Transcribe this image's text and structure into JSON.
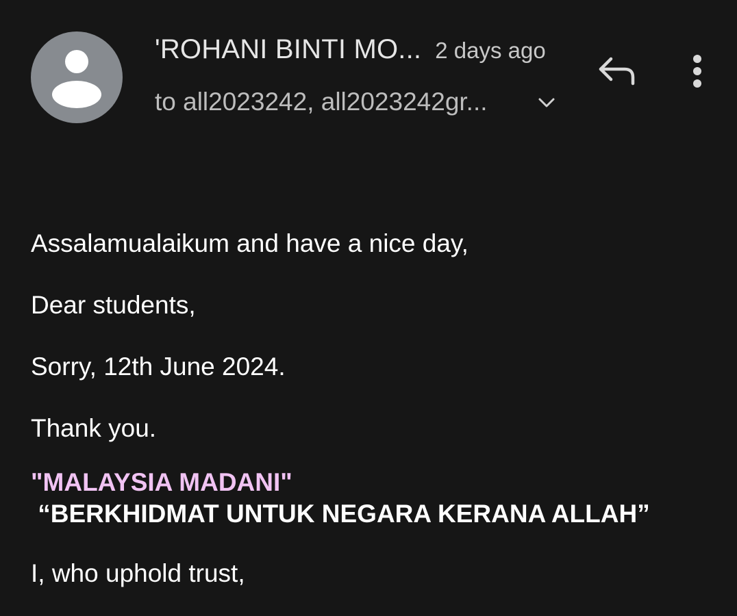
{
  "header": {
    "sender_name": "'ROHANI BINTI MO...",
    "time_ago": "2 days ago",
    "recipients": "to all2023242, all2023242gr...",
    "avatar_icon": "person-icon",
    "expand_icon": "chevron-down-icon",
    "reply_icon": "reply-icon",
    "more_icon": "more-vert-icon"
  },
  "body": {
    "greeting": "Assalamualaikum and have a nice day,",
    "salutation": "Dear students,",
    "line1": "Sorry, 12th June 2024.",
    "thanks": "Thank you.",
    "motto_line1": "\"MALAYSIA MADANI\"",
    "motto_line2": " “BERKHIDMAT UNTUK NEGARA KERANA ALLAH”",
    "closing": "I, who uphold trust,"
  },
  "colors": {
    "background": "#161616",
    "motto_pink": "#f1c3f3",
    "avatar_bg": "#878b90"
  }
}
